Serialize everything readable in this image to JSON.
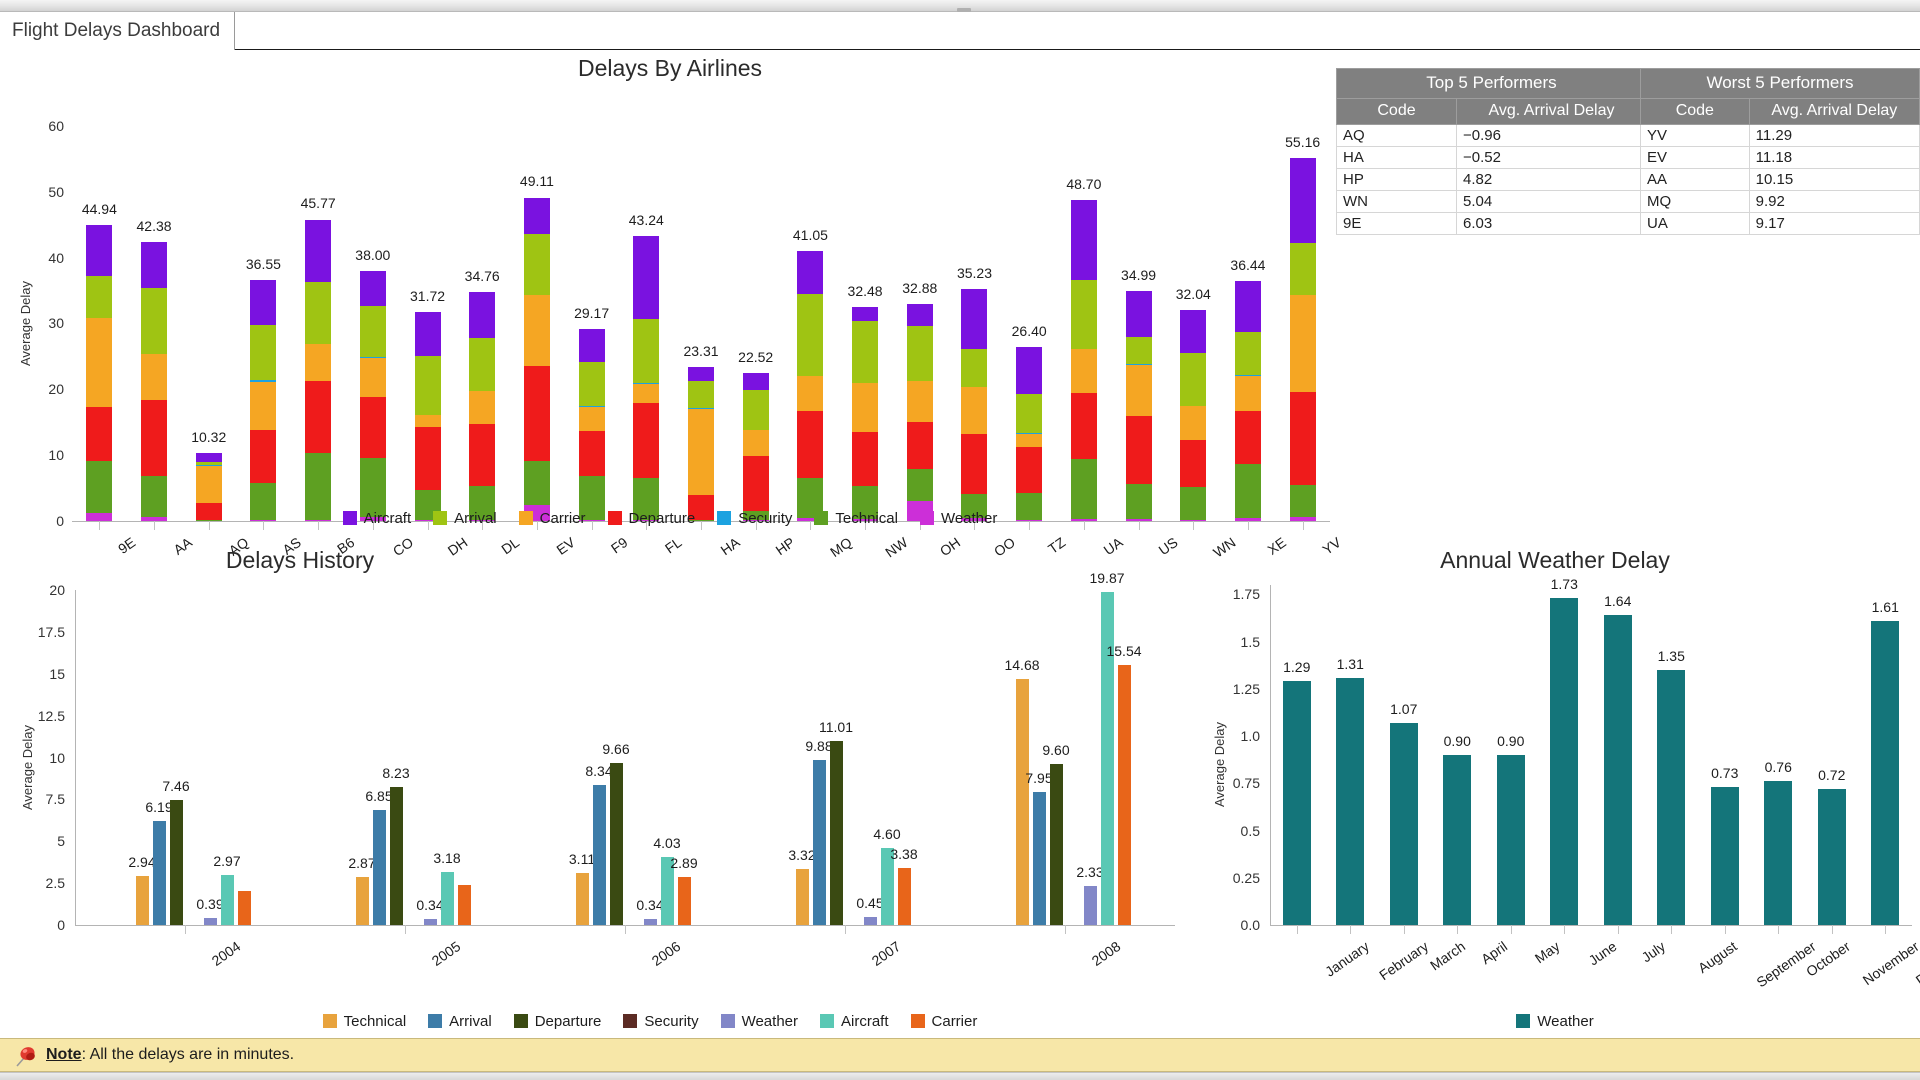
{
  "window": {
    "tab_label": "Flight Delays Dashboard"
  },
  "note": {
    "label": "Note",
    "text": ": All the delays are in minutes.",
    "icon": "pushpin-icon"
  },
  "tables": {
    "top": {
      "title": "Top 5 Performers",
      "columns": [
        "Code",
        "Avg. Arrival Delay"
      ],
      "rows": [
        [
          "AQ",
          "−0.96"
        ],
        [
          "HA",
          "−0.52"
        ],
        [
          "HP",
          "4.82"
        ],
        [
          "WN",
          "5.04"
        ],
        [
          "9E",
          "6.03"
        ]
      ]
    },
    "worst": {
      "title": "Worst 5 Performers",
      "columns": [
        "Code",
        "Avg. Arrival Delay"
      ],
      "rows": [
        [
          "YV",
          "11.29"
        ],
        [
          "EV",
          "11.18"
        ],
        [
          "AA",
          "10.15"
        ],
        [
          "MQ",
          "9.92"
        ],
        [
          "UA",
          "9.17"
        ]
      ]
    }
  },
  "colors": {
    "aircraft": "#7a12e0",
    "arrival": "#9fc413",
    "carrier": "#f5a623",
    "departure": "#ef1b1b",
    "security": "#1ca2e0",
    "technical": "#5ea022",
    "weather": "#cc2fd8",
    "h_technical": "#e8a33d",
    "h_arrival": "#3d7ca8",
    "h_departure": "#3a4a12",
    "h_security": "#5c2b24",
    "h_weather": "#8287c8",
    "h_aircraft": "#5ac8b4",
    "h_carrier": "#e8651a",
    "teal": "#14757a",
    "table_header": "#808080",
    "note_bg": "#f7e7a8"
  },
  "chart_data": [
    {
      "type": "bar",
      "id": "delays-by-airlines",
      "stacked": true,
      "title": "Delays By Airlines",
      "xlabel": "",
      "ylabel": "Average Delay",
      "ylim": [
        0,
        63
      ],
      "yticks": [
        0,
        10,
        20,
        30,
        40,
        50,
        60
      ],
      "grid": false,
      "legend_position": "bottom",
      "categories": [
        "9E",
        "AA",
        "AQ",
        "AS",
        "B6",
        "CO",
        "DH",
        "DL",
        "EV",
        "F9",
        "FL",
        "HA",
        "HP",
        "MQ",
        "NW",
        "OH",
        "OO",
        "TZ",
        "UA",
        "US",
        "WN",
        "XE",
        "YV"
      ],
      "totals": [
        44.94,
        42.38,
        10.32,
        36.55,
        45.77,
        38.0,
        31.72,
        34.76,
        49.11,
        29.17,
        43.24,
        23.31,
        22.52,
        41.05,
        32.48,
        32.88,
        35.23,
        26.4,
        48.7,
        34.99,
        32.04,
        36.44,
        55.16
      ],
      "series": [
        {
          "name": "Weather",
          "values": [
            1.29,
            0.55,
            0.1,
            0.18,
            0.2,
            0.55,
            0.12,
            0.16,
            2.39,
            0.1,
            0.2,
            0.1,
            0.18,
            0.5,
            0.38,
            3.0,
            0.46,
            0.1,
            0.24,
            0.35,
            0.2,
            0.52,
            0.55
          ]
        },
        {
          "name": "Technical",
          "values": [
            7.8,
            6.27,
            0.05,
            5.6,
            10.1,
            9.05,
            4.52,
            5.22,
            6.7,
            6.7,
            6.4,
            0.1,
            1.32,
            6.0,
            4.9,
            4.9,
            3.58,
            4.1,
            9.2,
            5.3,
            4.9,
            8.1,
            4.9
          ]
        },
        {
          "name": "Departure",
          "values": [
            8.2,
            11.55,
            2.56,
            8.05,
            11.0,
            9.25,
            9.7,
            9.4,
            14.5,
            6.9,
            11.3,
            3.8,
            8.4,
            10.2,
            8.2,
            7.1,
            9.1,
            7.1,
            10.1,
            10.3,
            7.2,
            8.1,
            14.1
          ]
        },
        {
          "name": "Carrier",
          "values": [
            13.55,
            6.95,
            5.7,
            7.3,
            5.6,
            6.0,
            1.8,
            5.0,
            10.7,
            3.7,
            3.0,
            13.1,
            3.9,
            5.3,
            7.5,
            6.2,
            7.2,
            2.0,
            6.6,
            7.8,
            5.2,
            5.4,
            14.8
          ]
        },
        {
          "name": "Security",
          "values": [
            0.05,
            0.02,
            0.02,
            0.35,
            0.02,
            0.02,
            0.02,
            0.02,
            0.02,
            0.02,
            0.02,
            0.02,
            0.02,
            0.02,
            0.02,
            0.02,
            0.02,
            0.02,
            0.02,
            0.02,
            0.02,
            0.02,
            0.02
          ]
        },
        {
          "name": "Arrival",
          "values": [
            6.25,
            10.1,
            0.6,
            8.3,
            9.3,
            7.7,
            8.9,
            8.0,
            9.2,
            6.7,
            9.7,
            4.1,
            6.1,
            12.4,
            9.3,
            8.3,
            5.7,
            6.0,
            10.5,
            4.2,
            8.0,
            6.6,
            7.8
          ]
        },
        {
          "name": "Aircraft",
          "values": [
            7.8,
            6.94,
            1.29,
            6.77,
            9.55,
            5.43,
            6.66,
            6.96,
            5.6,
            5.05,
            12.62,
            2.09,
            2.6,
            6.63,
            2.18,
            3.34,
            9.17,
            7.08,
            12.12,
            7.02,
            6.52,
            7.7,
            12.99
          ]
        }
      ]
    },
    {
      "type": "bar",
      "id": "delays-history",
      "stacked": false,
      "title": "Delays History",
      "xlabel": "",
      "ylabel": "Average Delay",
      "ylim": [
        0,
        20
      ],
      "yticks": [
        0,
        2.5,
        5,
        7.5,
        10,
        12.5,
        15,
        17.5,
        20
      ],
      "ytick_labels": [
        "0",
        "2.5",
        "5",
        "7.5",
        "10",
        "12.5",
        "15",
        "17.5",
        "20"
      ],
      "grid": false,
      "legend_position": "bottom",
      "categories": [
        "2004",
        "2005",
        "2006",
        "2007",
        "2008"
      ],
      "series": [
        {
          "name": "Technical",
          "values": [
            2.94,
            2.87,
            3.11,
            3.32,
            14.68
          ]
        },
        {
          "name": "Arrival",
          "values": [
            6.19,
            6.85,
            8.34,
            9.88,
            7.95
          ]
        },
        {
          "name": "Departure",
          "values": [
            7.46,
            8.23,
            9.66,
            11.01,
            9.6
          ]
        },
        {
          "name": "Security",
          "values": [
            null,
            null,
            null,
            null,
            null
          ]
        },
        {
          "name": "Weather",
          "values": [
            0.39,
            0.34,
            0.34,
            0.45,
            2.33
          ]
        },
        {
          "name": "Aircraft",
          "values": [
            2.97,
            3.18,
            4.03,
            4.6,
            19.87
          ]
        },
        {
          "name": "Carrier",
          "values": [
            2.05,
            2.41,
            2.89,
            3.38,
            15.54
          ]
        }
      ],
      "labeled_values": {
        "2004": [
          "2.94",
          "6.19",
          "7.46",
          "",
          "0.39",
          "2.97",
          ""
        ],
        "2005": [
          "2.87",
          "6.85",
          "8.23",
          "",
          "0.34",
          "3.18",
          ""
        ],
        "2006": [
          "3.11",
          "8.34",
          "9.66",
          "",
          "0.34",
          "4.03",
          "2.89"
        ],
        "2007": [
          "3.32",
          "9.88",
          "11.01",
          "",
          "0.45",
          "4.60",
          "3.38"
        ],
        "2008": [
          "14.68",
          "7.95",
          "9.60",
          "",
          "2.33",
          "19.87",
          "15.54"
        ]
      }
    },
    {
      "type": "bar",
      "id": "annual-weather-delay",
      "stacked": false,
      "title": "Annual Weather Delay",
      "xlabel": "",
      "ylabel": "Average Delay",
      "ylim": [
        0,
        1.8
      ],
      "yticks": [
        0,
        0.25,
        0.5,
        0.75,
        1.0,
        1.25,
        1.5,
        1.75
      ],
      "ytick_labels": [
        "0.0",
        "0.25",
        "0.5",
        "0.75",
        "1.0",
        "1.25",
        "1.5",
        "1.75"
      ],
      "grid": false,
      "legend_position": "bottom",
      "categories": [
        "January",
        "February",
        "March",
        "April",
        "May",
        "June",
        "July",
        "August",
        "September",
        "October",
        "November",
        "December"
      ],
      "series": [
        {
          "name": "Weather",
          "values": [
            1.29,
            1.31,
            1.07,
            0.9,
            0.9,
            1.73,
            1.64,
            1.35,
            0.73,
            0.76,
            0.72,
            1.61
          ]
        }
      ]
    }
  ],
  "legends": {
    "airlines": [
      "Aircraft",
      "Arrival",
      "Carrier",
      "Departure",
      "Security",
      "Technical",
      "Weather"
    ],
    "history": [
      "Technical",
      "Arrival",
      "Departure",
      "Security",
      "Weather",
      "Aircraft",
      "Carrier"
    ],
    "weather": [
      "Weather"
    ]
  }
}
